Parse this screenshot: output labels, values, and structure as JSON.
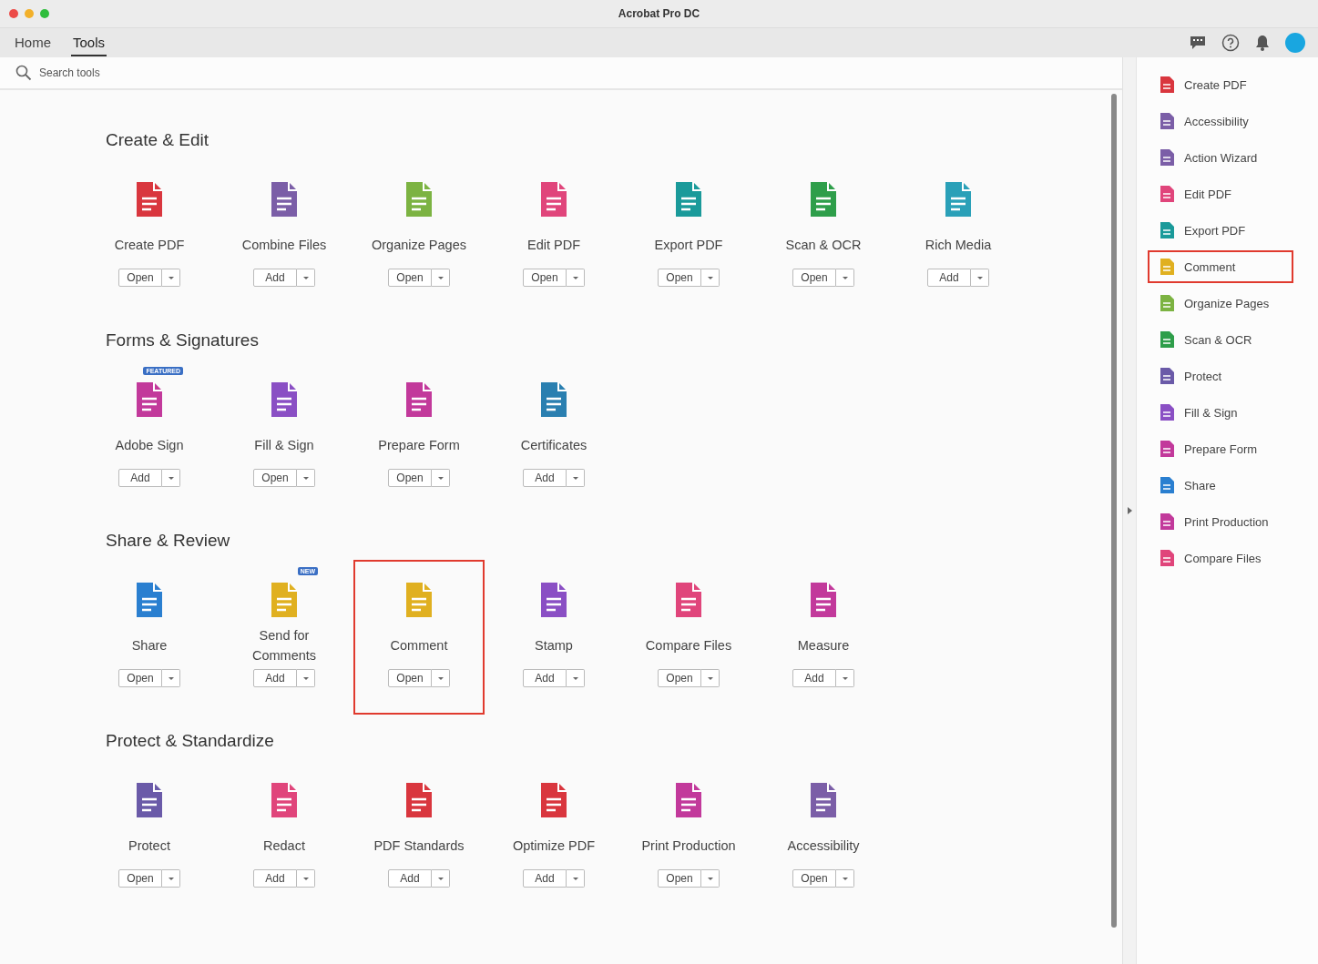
{
  "window": {
    "title": "Acrobat Pro DC"
  },
  "tabs": [
    {
      "label": "Home",
      "selected": false
    },
    {
      "label": "Tools",
      "selected": true
    }
  ],
  "search": {
    "placeholder": "Search tools"
  },
  "sections": [
    {
      "title": "Create & Edit",
      "tools": [
        {
          "name": "Create PDF",
          "action": "Open",
          "color": "#d9363e",
          "highlighted": false
        },
        {
          "name": "Combine Files",
          "action": "Add",
          "color": "#7b5ea7",
          "highlighted": false
        },
        {
          "name": "Organize Pages",
          "action": "Open",
          "color": "#7cb342",
          "highlighted": false
        },
        {
          "name": "Edit PDF",
          "action": "Open",
          "color": "#e0457b",
          "highlighted": false
        },
        {
          "name": "Export PDF",
          "action": "Open",
          "color": "#1a9a9a",
          "highlighted": false
        },
        {
          "name": "Scan & OCR",
          "action": "Open",
          "color": "#2e9e4a",
          "highlighted": false
        },
        {
          "name": "Rich Media",
          "action": "Add",
          "color": "#2aa0b8",
          "highlighted": false
        }
      ]
    },
    {
      "title": "Forms & Signatures",
      "tools": [
        {
          "name": "Adobe Sign",
          "action": "Add",
          "color": "#c2399b",
          "highlighted": false,
          "badge": "FEATURED"
        },
        {
          "name": "Fill & Sign",
          "action": "Open",
          "color": "#8a4fc4",
          "highlighted": false
        },
        {
          "name": "Prepare Form",
          "action": "Open",
          "color": "#c2399b",
          "highlighted": false
        },
        {
          "name": "Certificates",
          "action": "Add",
          "color": "#2a7fb0",
          "highlighted": false
        }
      ]
    },
    {
      "title": "Share & Review",
      "tools": [
        {
          "name": "Share",
          "action": "Open",
          "color": "#2a7fd0",
          "highlighted": false
        },
        {
          "name": "Send for Comments",
          "action": "Add",
          "color": "#e0b020",
          "highlighted": false,
          "badge": "NEW"
        },
        {
          "name": "Comment",
          "action": "Open",
          "color": "#e0b020",
          "highlighted": true
        },
        {
          "name": "Stamp",
          "action": "Add",
          "color": "#8a4fc4",
          "highlighted": false
        },
        {
          "name": "Compare Files",
          "action": "Open",
          "color": "#e0457b",
          "highlighted": false
        },
        {
          "name": "Measure",
          "action": "Add",
          "color": "#c2399b",
          "highlighted": false
        }
      ]
    },
    {
      "title": "Protect & Standardize",
      "tools": [
        {
          "name": "Protect",
          "action": "Open",
          "color": "#6a5aa8",
          "highlighted": false
        },
        {
          "name": "Redact",
          "action": "Add",
          "color": "#e0457b",
          "highlighted": false
        },
        {
          "name": "PDF Standards",
          "action": "Add",
          "color": "#d9363e",
          "highlighted": false
        },
        {
          "name": "Optimize PDF",
          "action": "Add",
          "color": "#d9363e",
          "highlighted": false
        },
        {
          "name": "Print Production",
          "action": "Open",
          "color": "#c2399b",
          "highlighted": false
        },
        {
          "name": "Accessibility",
          "action": "Open",
          "color": "#7b5ea7",
          "highlighted": false
        }
      ]
    }
  ],
  "sidebar": {
    "items": [
      {
        "label": "Create PDF",
        "color": "#d9363e",
        "highlighted": false
      },
      {
        "label": "Accessibility",
        "color": "#7b5ea7",
        "highlighted": false
      },
      {
        "label": "Action Wizard",
        "color": "#7b5ea7",
        "highlighted": false
      },
      {
        "label": "Edit PDF",
        "color": "#e0457b",
        "highlighted": false
      },
      {
        "label": "Export PDF",
        "color": "#1a9a9a",
        "highlighted": false
      },
      {
        "label": "Comment",
        "color": "#e0b020",
        "highlighted": true
      },
      {
        "label": "Organize Pages",
        "color": "#7cb342",
        "highlighted": false
      },
      {
        "label": "Scan & OCR",
        "color": "#2e9e4a",
        "highlighted": false
      },
      {
        "label": "Protect",
        "color": "#6a5aa8",
        "highlighted": false
      },
      {
        "label": "Fill & Sign",
        "color": "#8a4fc4",
        "highlighted": false
      },
      {
        "label": "Prepare Form",
        "color": "#c2399b",
        "highlighted": false
      },
      {
        "label": "Share",
        "color": "#2a7fd0",
        "highlighted": false
      },
      {
        "label": "Print Production",
        "color": "#c2399b",
        "highlighted": false
      },
      {
        "label": "Compare Files",
        "color": "#e0457b",
        "highlighted": false
      }
    ]
  }
}
